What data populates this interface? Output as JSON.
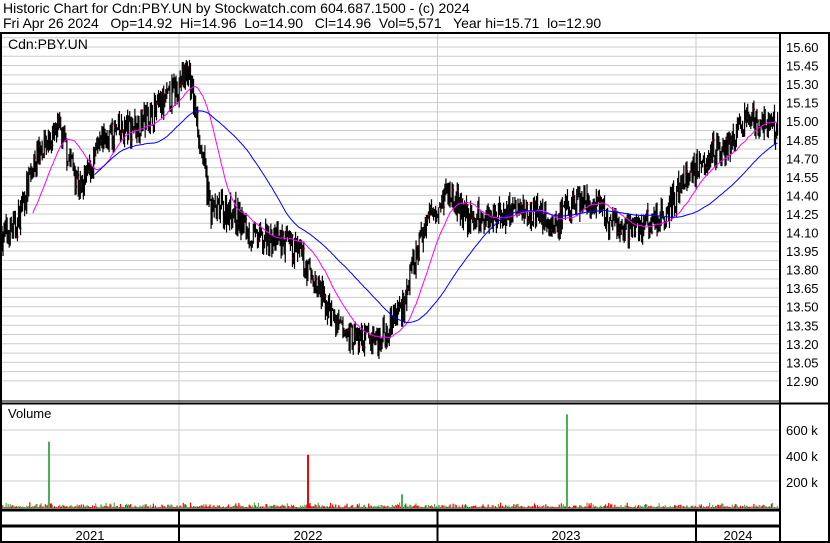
{
  "header": {
    "title": "Historic Chart for Cdn:PBY.UN by Stockwatch.com 604.687.1500 - (c) 2024",
    "quote": "Fri Apr 26 2024   Op=14.92  Hi=14.96  Lo=14.90   Cl=14.96  Vol=5,571   Year hi=15.71  lo=12.90"
  },
  "chart_data": [
    {
      "type": "line",
      "title": "Cdn:PBY.UN",
      "subtype": "daily high-low bars with short (magenta) and long (blue) moving averages",
      "ylim": [
        12.83,
        15.7
      ],
      "y_ticks": [
        "15.60",
        "15.45",
        "15.30",
        "15.15",
        "15.00",
        "14.85",
        "14.70",
        "14.55",
        "14.40",
        "14.25",
        "14.10",
        "13.95",
        "13.80",
        "13.65",
        "13.50",
        "13.35",
        "13.20",
        "13.05",
        "12.90"
      ],
      "x_tick_labels": [
        "2021",
        "2022",
        "2023",
        "2024"
      ],
      "x_range": [
        "2021-04",
        "2024-04"
      ],
      "grid": true,
      "monthly_close_approx": {
        "x": [
          "2021-04",
          "2021-05",
          "2021-06",
          "2021-07",
          "2021-08",
          "2021-09",
          "2021-10",
          "2021-11",
          "2021-12",
          "2022-01",
          "2022-02",
          "2022-03",
          "2022-04",
          "2022-05",
          "2022-06",
          "2022-07",
          "2022-08",
          "2022-09",
          "2022-10",
          "2022-11",
          "2022-12",
          "2023-01",
          "2023-02",
          "2023-03",
          "2023-04",
          "2023-05",
          "2023-06",
          "2023-07",
          "2023-08",
          "2023-09",
          "2023-10",
          "2023-11",
          "2023-12",
          "2024-01",
          "2024-02",
          "2024-03",
          "2024-04"
        ],
        "values": [
          14.08,
          14.16,
          14.77,
          14.93,
          14.44,
          14.85,
          14.93,
          15.01,
          15.17,
          15.41,
          14.28,
          14.28,
          14.04,
          14.04,
          13.96,
          13.63,
          13.31,
          13.23,
          13.27,
          13.55,
          14.2,
          14.44,
          14.2,
          14.24,
          14.28,
          14.28,
          14.16,
          14.36,
          14.28,
          14.12,
          14.16,
          14.24,
          14.52,
          14.73,
          14.81,
          15.01,
          14.94
        ]
      },
      "series": [
        {
          "name": "Price range",
          "color": "#000000"
        },
        {
          "name": "Close",
          "color": "#ff0000"
        },
        {
          "name": "Short MA",
          "color": "#ff00ff"
        },
        {
          "name": "Long MA",
          "color": "#0000ff"
        }
      ]
    },
    {
      "type": "bar",
      "title": "Volume",
      "ylim": [
        0,
        800000
      ],
      "y_ticks": [
        "600 k",
        "400 k",
        "200 k"
      ],
      "typical_daily_volume": 15000,
      "spikes": [
        {
          "date": "2021-06",
          "value": 510000,
          "color": "#4caf50"
        },
        {
          "date": "2022-08",
          "value": 105000,
          "color": "#4caf50"
        },
        {
          "date": "2022-09",
          "value": 410000,
          "color": "#ff0000"
        },
        {
          "date": "2023-07",
          "value": 720000,
          "color": "#4caf50"
        }
      ],
      "colors": {
        "up": "#4caf50",
        "down": "#ff0000",
        "flat": "#a0a0a0"
      }
    }
  ]
}
